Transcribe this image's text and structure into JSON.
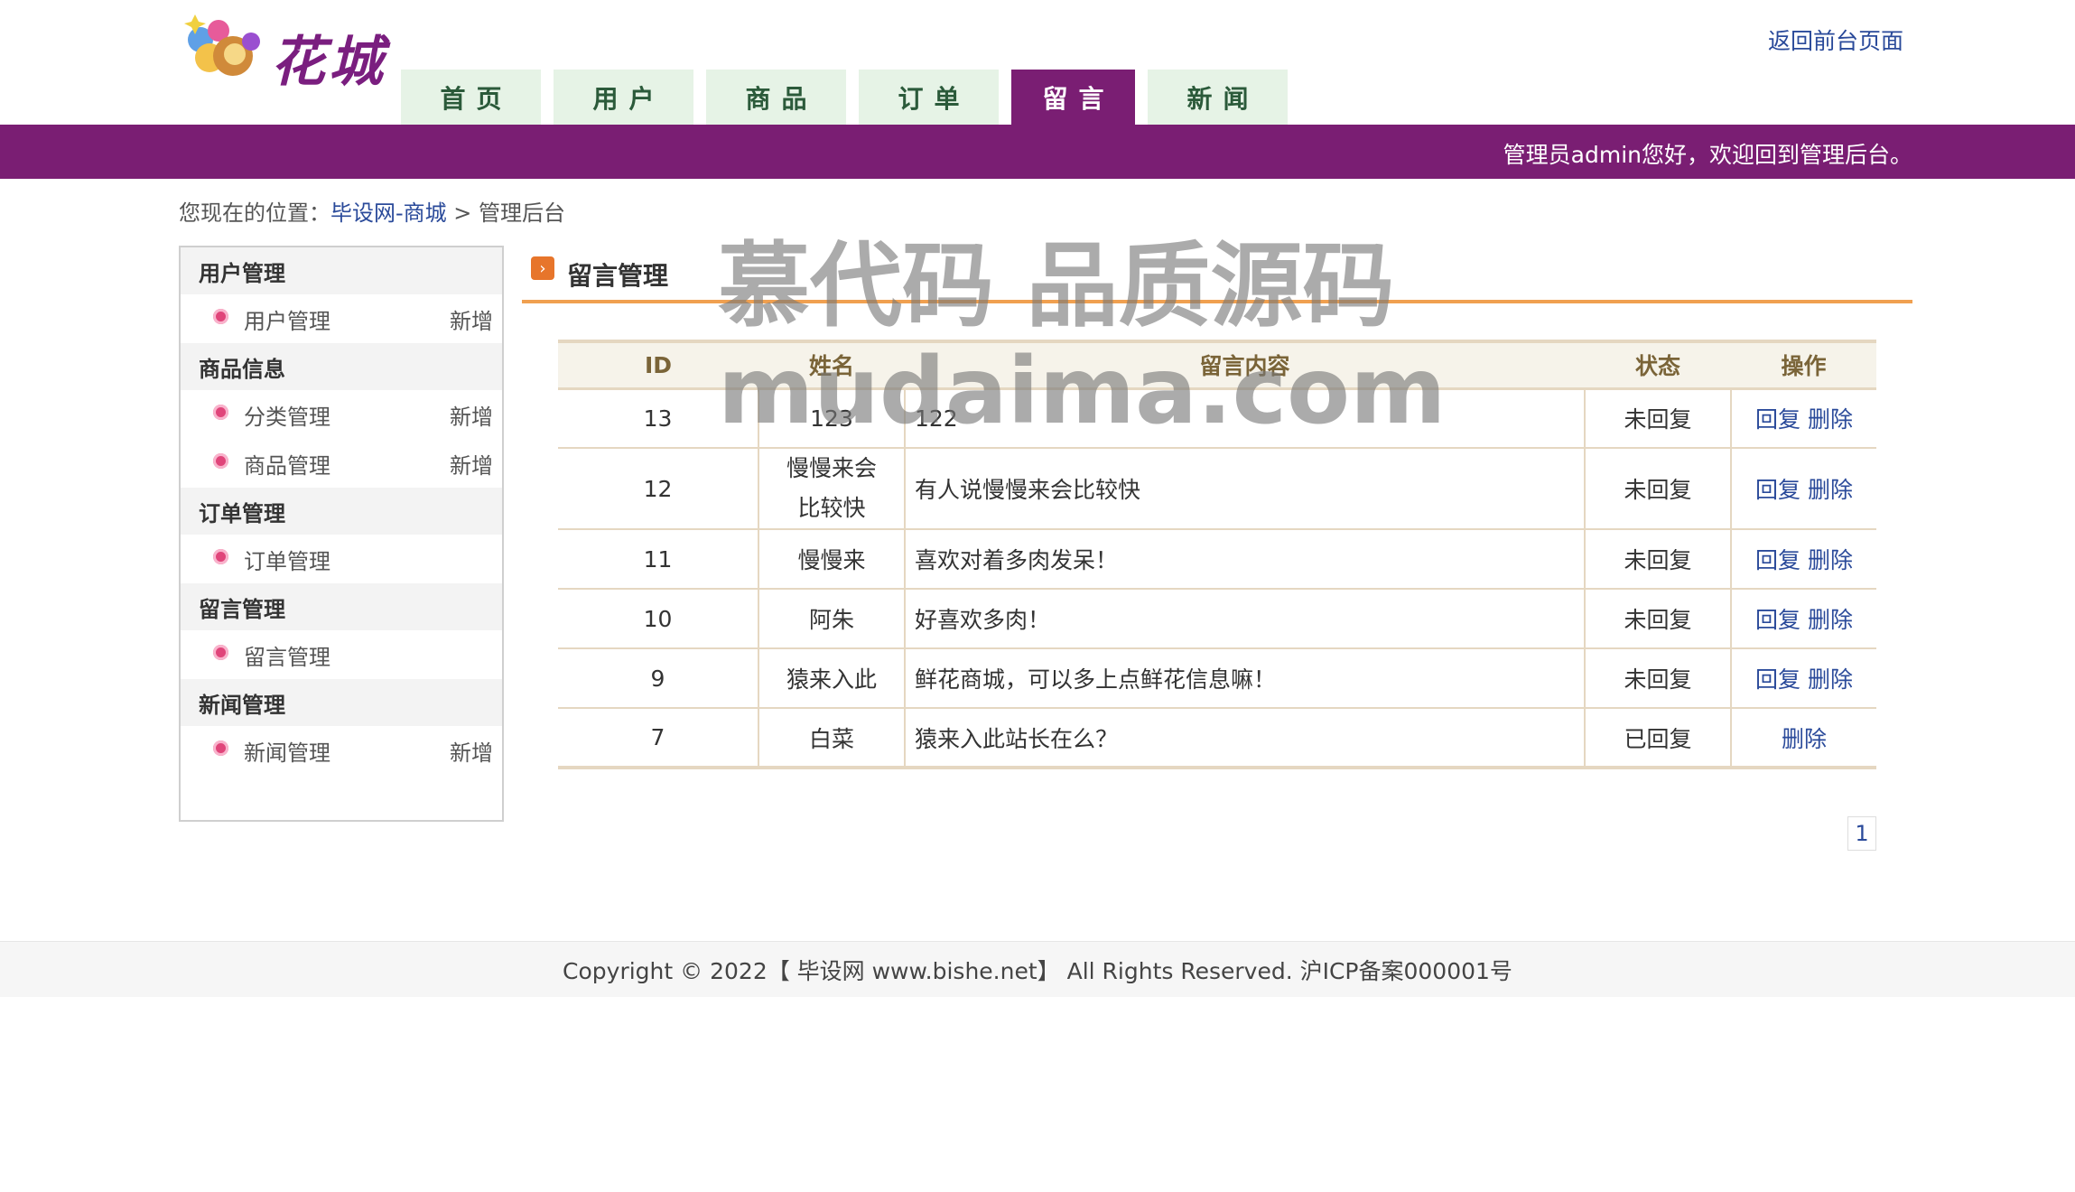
{
  "header": {
    "logo_text": "花城",
    "return_link": "返回前台页面"
  },
  "nav": {
    "tabs": [
      {
        "label": "首页"
      },
      {
        "label": "用户"
      },
      {
        "label": "商品"
      },
      {
        "label": "订单"
      },
      {
        "label": "留言",
        "active": true
      },
      {
        "label": "新闻"
      }
    ]
  },
  "banner": {
    "welcome": "管理员admin您好，欢迎回到管理后台。"
  },
  "breadcrumb": {
    "prefix": "您现在的位置：",
    "link": "毕设网-商城",
    "sep": " > ",
    "current": "管理后台"
  },
  "sidebar": {
    "groups": [
      {
        "title": "用户管理",
        "items": [
          {
            "label": "用户管理",
            "new": "新增"
          }
        ]
      },
      {
        "title": "商品信息",
        "items": [
          {
            "label": "分类管理",
            "new": "新增"
          },
          {
            "label": "商品管理",
            "new": "新增"
          }
        ]
      },
      {
        "title": "订单管理",
        "items": [
          {
            "label": "订单管理",
            "new": ""
          }
        ]
      },
      {
        "title": "留言管理",
        "items": [
          {
            "label": "留言管理",
            "new": ""
          }
        ]
      },
      {
        "title": "新闻管理",
        "items": [
          {
            "label": "新闻管理",
            "new": "新增"
          }
        ]
      }
    ]
  },
  "main": {
    "title": "留言管理",
    "watermark_line1": "慕代码 品质源码",
    "watermark_line2": "mudaima.com",
    "columns": [
      "ID",
      "姓名",
      "留言内容",
      "状态",
      "操作"
    ],
    "reply_label": "回复",
    "delete_label": "删除",
    "rows": [
      {
        "id": "13",
        "name": "123",
        "content": "122",
        "status": "未回复",
        "can_reply": true
      },
      {
        "id": "12",
        "name": "慢慢来会比较快",
        "content": "有人说慢慢来会比较快",
        "status": "未回复",
        "can_reply": true
      },
      {
        "id": "11",
        "name": "慢慢来",
        "content": "喜欢对着多肉发呆！",
        "status": "未回复",
        "can_reply": true
      },
      {
        "id": "10",
        "name": "阿朱",
        "content": "好喜欢多肉！",
        "status": "未回复",
        "can_reply": true
      },
      {
        "id": "9",
        "name": "猿来入此",
        "content": "鲜花商城，可以多上点鲜花信息嘛！",
        "status": "未回复",
        "can_reply": true
      },
      {
        "id": "7",
        "name": "白菜",
        "content": "猿来入此站长在么？",
        "status": "已回复",
        "can_reply": false
      }
    ],
    "page": "1"
  },
  "footer": {
    "copyright": "Copyright © 2022【 毕设网 www.bishe.net】 All Rights Reserved. 沪ICP备案000001号"
  },
  "colors": {
    "brand_purple": "#7a1e73",
    "accent_orange": "#f0a050",
    "link_blue": "#2a4a9a"
  }
}
